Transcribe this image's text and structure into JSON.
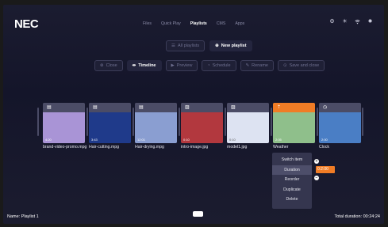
{
  "brand": "NEC",
  "nav": {
    "items": [
      "Files",
      "Quick Play",
      "Playlists",
      "CMS",
      "Apps"
    ],
    "active": "Playlists"
  },
  "top_icons": [
    "settings-gear-icon",
    "sun-icon",
    "wifi-icon",
    "cog-icon"
  ],
  "playlist_controls": {
    "all_playlists": "All playlists",
    "new_playlist": "New playlist"
  },
  "toolbar": {
    "close": "Close",
    "timeline": "Timeline",
    "preview": "Preview",
    "schedule": "Schedule",
    "rename": "Rename",
    "save_and_close": "Save and close"
  },
  "tiles": [
    {
      "name": "brand-video-promo.mpg",
      "duration": "4:20",
      "type": "video",
      "color": "#a994d6"
    },
    {
      "name": "Hair-cutting.mpg",
      "duration": "3:43",
      "type": "video",
      "color": "#1f3a8a"
    },
    {
      "name": "Hair-drying.mpg",
      "duration": "12:01",
      "type": "video",
      "color": "#8a9ed1"
    },
    {
      "name": "intro-image.jpg",
      "duration": "0:10",
      "type": "image",
      "color": "#b2383e"
    },
    {
      "name": "model1.jpg",
      "duration": "0:10",
      "type": "image",
      "color": "#dde3f2"
    },
    {
      "name": "Weather",
      "duration": "2:05",
      "type": "app",
      "color": "#8fbf8b"
    },
    {
      "name": "Clock",
      "duration": "2:00",
      "type": "clock",
      "color": "#4a7ec5"
    }
  ],
  "context_menu": {
    "items": [
      "Switch item",
      "Duration",
      "Reorder",
      "Duplicate",
      "Delete"
    ],
    "highlighted": "Duration",
    "duration_value": "0:2:00"
  },
  "footer": {
    "name": "Name: Playlist 1",
    "total": "Total duration: 00:24:24"
  },
  "colors": {
    "accent": "#f07c25",
    "background": "#181a2e",
    "tile_bg": "#3c3d55"
  }
}
